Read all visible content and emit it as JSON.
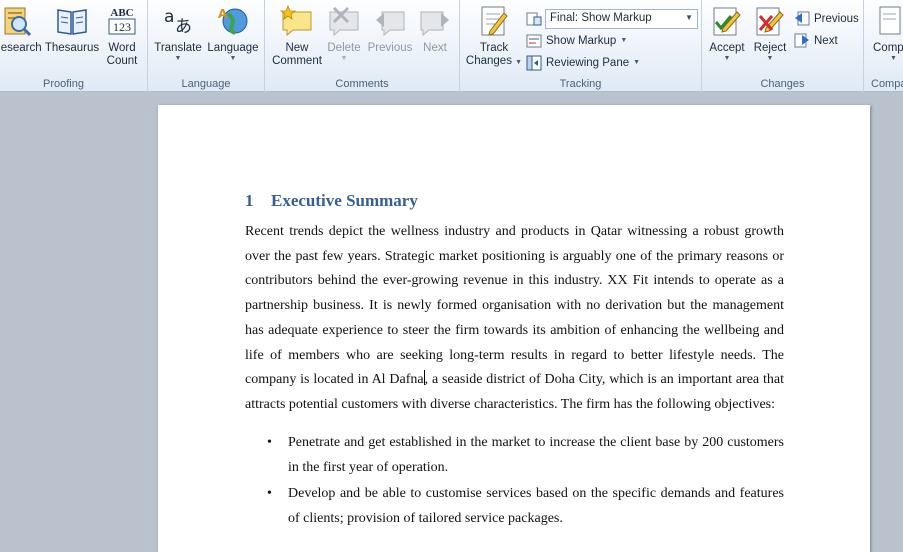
{
  "ribbon": {
    "proofing": {
      "label": "Proofing",
      "research": "Research",
      "thesaurus": "Thesaurus",
      "word_count_line1": "Word",
      "word_count_line2": "Count"
    },
    "language": {
      "label": "Language",
      "translate": "Translate",
      "language": "Language"
    },
    "comments": {
      "label": "Comments",
      "new_line1": "New",
      "new_line2": "Comment",
      "delete": "Delete",
      "previous": "Previous",
      "next": "Next"
    },
    "tracking": {
      "label": "Tracking",
      "track_line1": "Track",
      "track_line2": "Changes",
      "display_for_review": "Final: Show Markup",
      "show_markup": "Show Markup",
      "reviewing_pane": "Reviewing Pane"
    },
    "changes": {
      "label": "Changes",
      "accept": "Accept",
      "reject": "Reject",
      "previous": "Previous",
      "next": "Next"
    },
    "compare": {
      "label": "Compa",
      "button": "Compa"
    }
  },
  "document": {
    "heading_number": "1",
    "heading_text": "Executive Summary",
    "para_before_cursor": "Recent trends depict the wellness industry and products in Qatar witnessing a robust growth over the past few years. Strategic market positioning is arguably one of the primary reasons or contributors behind the ever-growing revenue in this industry. XX Fit intends to operate as a partnership business. It is newly formed organisation with no derivation but the management has adequate experience to steer the firm towards its ambition of enhancing the wellbeing and life of members who are seeking long-term results in regard to better lifestyle needs. The company is located in Al Dafna",
    "para_after_cursor": ", a seaside district of Doha City, which is an important area that attracts potential customers with diverse characteristics. The firm has the following objectives:",
    "bullets": [
      "Penetrate and get established in the market to increase the client base by 200 customers in the first year of operation.",
      "Develop and be able to customise services based on the specific demands and features of clients; provision of tailored service packages."
    ],
    "bullet_glyph": "•"
  },
  "colors": {
    "heading": "#365f91",
    "ribbon_text": "#1e395b",
    "workspace": "#b9c2cd"
  }
}
